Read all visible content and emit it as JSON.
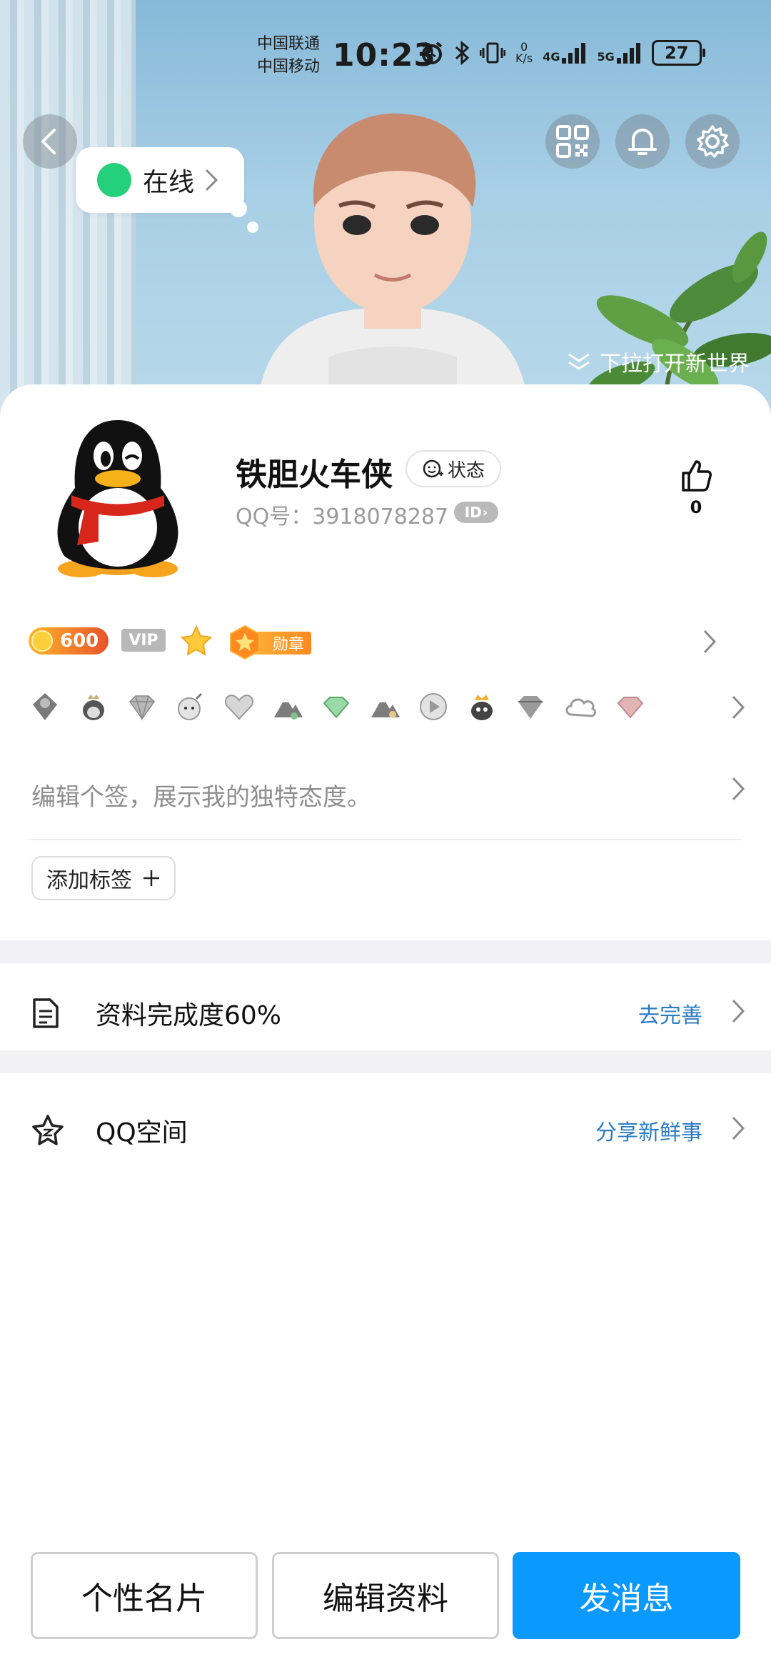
{
  "status_bar": {
    "carrier1": "中国联通",
    "carrier2": "中国移动",
    "time": "10:23",
    "net_speed_value": "0",
    "net_speed_unit": "K/s",
    "net1": "4G",
    "net2": "5G",
    "battery": "27"
  },
  "header": {
    "online_status": "在线",
    "pull_hint": "下拉打开新世界",
    "icons": [
      "back-icon",
      "qr-code-icon",
      "bell-icon",
      "gear-icon"
    ]
  },
  "profile": {
    "nickname": "铁胆火车侠",
    "status_chip": "状态",
    "qq_number": "QQ号：3918078287",
    "id_badge": "ID",
    "like_count": "0"
  },
  "badges": {
    "level": "600",
    "vip": "VIP",
    "medal": "勋章"
  },
  "signature_placeholder": "编辑个签，展示我的独特态度。",
  "add_tag_label": "添加标签",
  "rows": {
    "profile_completion": {
      "label": "资料完成度60%",
      "action": "去完善"
    },
    "qzone": {
      "label": "QQ空间",
      "action": "分享新鲜事"
    }
  },
  "bottom_buttons": {
    "card": "个性名片",
    "edit": "编辑资料",
    "message": "发消息"
  },
  "colors": {
    "accent_blue": "#0a99ff",
    "link_blue": "#2b7cc6",
    "online_green": "#24d17a"
  }
}
